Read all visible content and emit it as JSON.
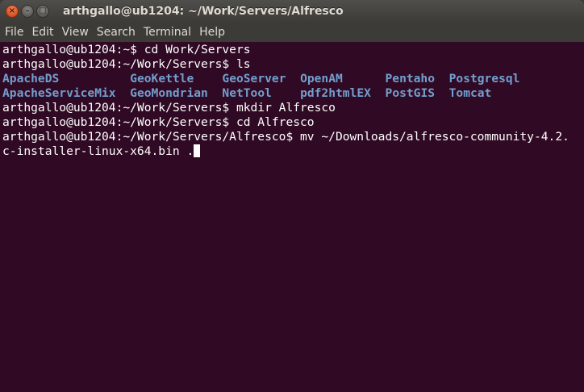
{
  "window": {
    "title": "arthgallo@ub1204: ~/Work/Servers/Alfresco",
    "buttons": {
      "close_glyph": "×",
      "minimize_glyph": "–",
      "maximize_glyph": "□"
    }
  },
  "menubar": {
    "items": [
      "File",
      "Edit",
      "View",
      "Search",
      "Terminal",
      "Help"
    ]
  },
  "terminal": {
    "line1": "arthgallo@ub1204:~$ cd Work/Servers",
    "line2": "arthgallo@ub1204:~/Work/Servers$ ls",
    "ls_row1": [
      "ApacheDS",
      "GeoKettle",
      "GeoServer",
      "OpenAM",
      "Pentaho",
      "Postgresql"
    ],
    "ls_row2": [
      "ApacheServiceMix",
      "GeoMondrian",
      "NetTool",
      "pdf2htmlEX",
      "PostGIS",
      "Tomcat"
    ],
    "line5": "arthgallo@ub1204:~/Work/Servers$ mkdir Alfresco",
    "line6": "arthgallo@ub1204:~/Work/Servers$ cd Alfresco",
    "line7": "arthgallo@ub1204:~/Work/Servers/Alfresco$ mv ~/Downloads/alfresco-community-4.2.",
    "line8": "c-installer-linux-x64.bin ."
  },
  "colors": {
    "terminal_bg": "#300a24",
    "terminal_fg": "#ffffff",
    "directory": "#729fcf",
    "chrome_bg": "#3c3b37",
    "close_button": "#e05a2a"
  }
}
